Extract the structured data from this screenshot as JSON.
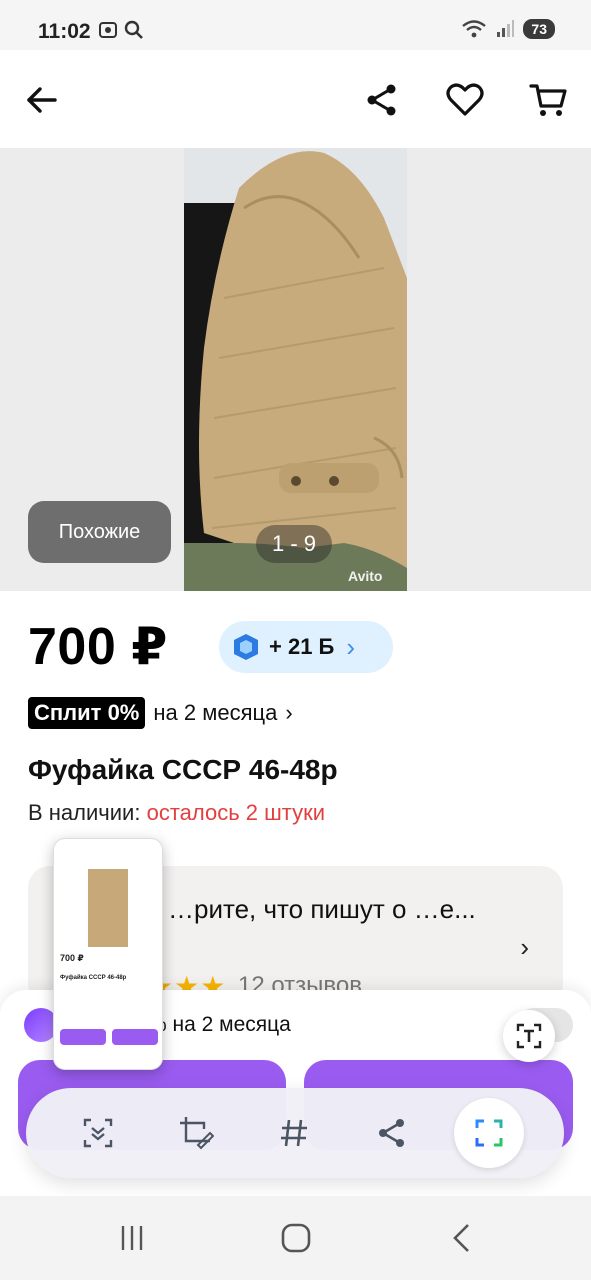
{
  "status_bar": {
    "time": "11:02",
    "battery": "73"
  },
  "header": {
    "back_icon": "arrow-left-icon",
    "share_icon": "share-icon",
    "favorite_icon": "heart-icon",
    "cart_icon": "cart-icon"
  },
  "gallery": {
    "similar_label": "Похожие",
    "counter": "1 - 9",
    "watermark": "Avito"
  },
  "listing": {
    "price": "700 ₽",
    "bonus": "+ 21 Б",
    "split_badge": "Сплит 0%",
    "split_text": "на 2 месяца",
    "title": "Фуфайка СССР 46-48р",
    "stock_label": "В наличии:",
    "stock_value": "осталось 2 штуки"
  },
  "reviews": {
    "title": "…рите, что пишут о …е...",
    "count": "12 отзывов",
    "stars": "★★★"
  },
  "bottom_sheet": {
    "split_text": "% на 2 месяца"
  },
  "toolbar": {
    "items": [
      "scroll-capture-icon",
      "crop-edit-icon",
      "hashtag-icon",
      "share-icon",
      "smart-select-icon"
    ]
  },
  "colors": {
    "accent_purple": "#9a5cf0",
    "warning_red": "#e2403f",
    "bonus_bg": "#dff0ff",
    "star": "#f7b500"
  }
}
